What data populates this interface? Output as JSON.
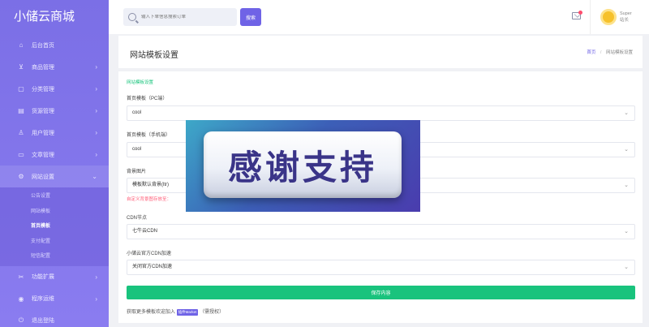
{
  "app": {
    "title": "小储云商城"
  },
  "sidebar": {
    "items": [
      {
        "icon": "home-icon",
        "glyph": "⌂",
        "label": "后台首页",
        "chevron": ""
      },
      {
        "icon": "cart-icon",
        "glyph": "⊻",
        "label": "商品管理",
        "chevron": "›"
      },
      {
        "icon": "category-icon",
        "glyph": "▢",
        "label": "分类管理",
        "chevron": "›"
      },
      {
        "icon": "orders-icon",
        "glyph": "▤",
        "label": "货源管理",
        "chevron": "›"
      },
      {
        "icon": "user-icon",
        "glyph": "♙",
        "label": "用户管理",
        "chevron": "›"
      },
      {
        "icon": "article-icon",
        "glyph": "▭",
        "label": "文章管理",
        "chevron": "›"
      },
      {
        "icon": "gear-icon",
        "glyph": "⚙",
        "label": "网站设置",
        "chevron": "⌄"
      }
    ],
    "sub_items": [
      "公告设置",
      "网站模板",
      "首页模板",
      "支付配置",
      "短信配置"
    ],
    "after_items": [
      {
        "icon": "extension-icon",
        "glyph": "✂",
        "label": "功能扩展",
        "chevron": "›"
      },
      {
        "icon": "ops-icon",
        "glyph": "◉",
        "label": "程序运维",
        "chevron": "›"
      },
      {
        "icon": "power-icon",
        "glyph": "⏻",
        "label": "退出登陆",
        "chevron": ""
      }
    ]
  },
  "topbar": {
    "search_placeholder": "输入下单信息搜索订单",
    "search_button": "搜索",
    "user_name": "Super",
    "user_role": "站长"
  },
  "header": {
    "page_title": "网站模板设置",
    "breadcrumb_home": "首页",
    "breadcrumb_sep": "/",
    "breadcrumb_current": "网站模板设置"
  },
  "form": {
    "section_title": "网站模板设置",
    "fields": [
      {
        "label": "首页模板（PC端）",
        "value": "cool"
      },
      {
        "label": "首页模板（手机端）",
        "value": "cool"
      },
      {
        "label": "背景图片",
        "value": "模板默认背景(ltr)"
      },
      {
        "label": "CDN节点",
        "value": "七牛云CDN"
      },
      {
        "label": "小储云官方CDN加速",
        "value": "关闭官方CDN加速"
      }
    ],
    "hint": "自定义背景图存放至：",
    "save_button": "保存内容",
    "footer_text": "获取更多模板欢迎加入",
    "footer_tag": "插件Market",
    "footer_suffix": "（需授权）"
  },
  "overlay": {
    "text": "感谢支持"
  },
  "colors": {
    "accent": "#6f63e6",
    "sidebar": "#8073ea",
    "save": "#19c37d",
    "hint": "#ff5a76"
  }
}
